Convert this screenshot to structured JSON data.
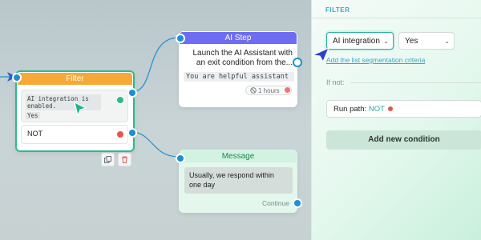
{
  "filter_node": {
    "title": "Filter",
    "condition_text": "AI integration is enabled.",
    "condition_value": "Yes",
    "not_label": "NOT",
    "copy_icon": "copy-icon",
    "delete_icon": "trash-icon"
  },
  "ai_step_node": {
    "title": "AI Step",
    "description": "Launch the AI Assistant with an exit condition from the...",
    "prompt": "You are helpful assistant",
    "timeout": "1 hours",
    "timeout_icon": "clock-icon"
  },
  "message_node": {
    "title": "Message",
    "body": "Usually, we respond within one day",
    "footer": "Continue"
  },
  "panel": {
    "title": "FILTER",
    "field_select": "AI integration",
    "value_select": "Yes",
    "segmentation_link": "Add the list segmentation criteria",
    "if_not_label": "If not:",
    "run_path_label": "Run path:",
    "run_path_value": "NOT",
    "add_condition": "Add new condition"
  },
  "colors": {
    "filter_header": "#f7a938",
    "ai_header": "#6e6cf3",
    "message_header_text": "#1e8a4a",
    "accent": "#37a8c9",
    "node_border": "#2fb98b"
  }
}
